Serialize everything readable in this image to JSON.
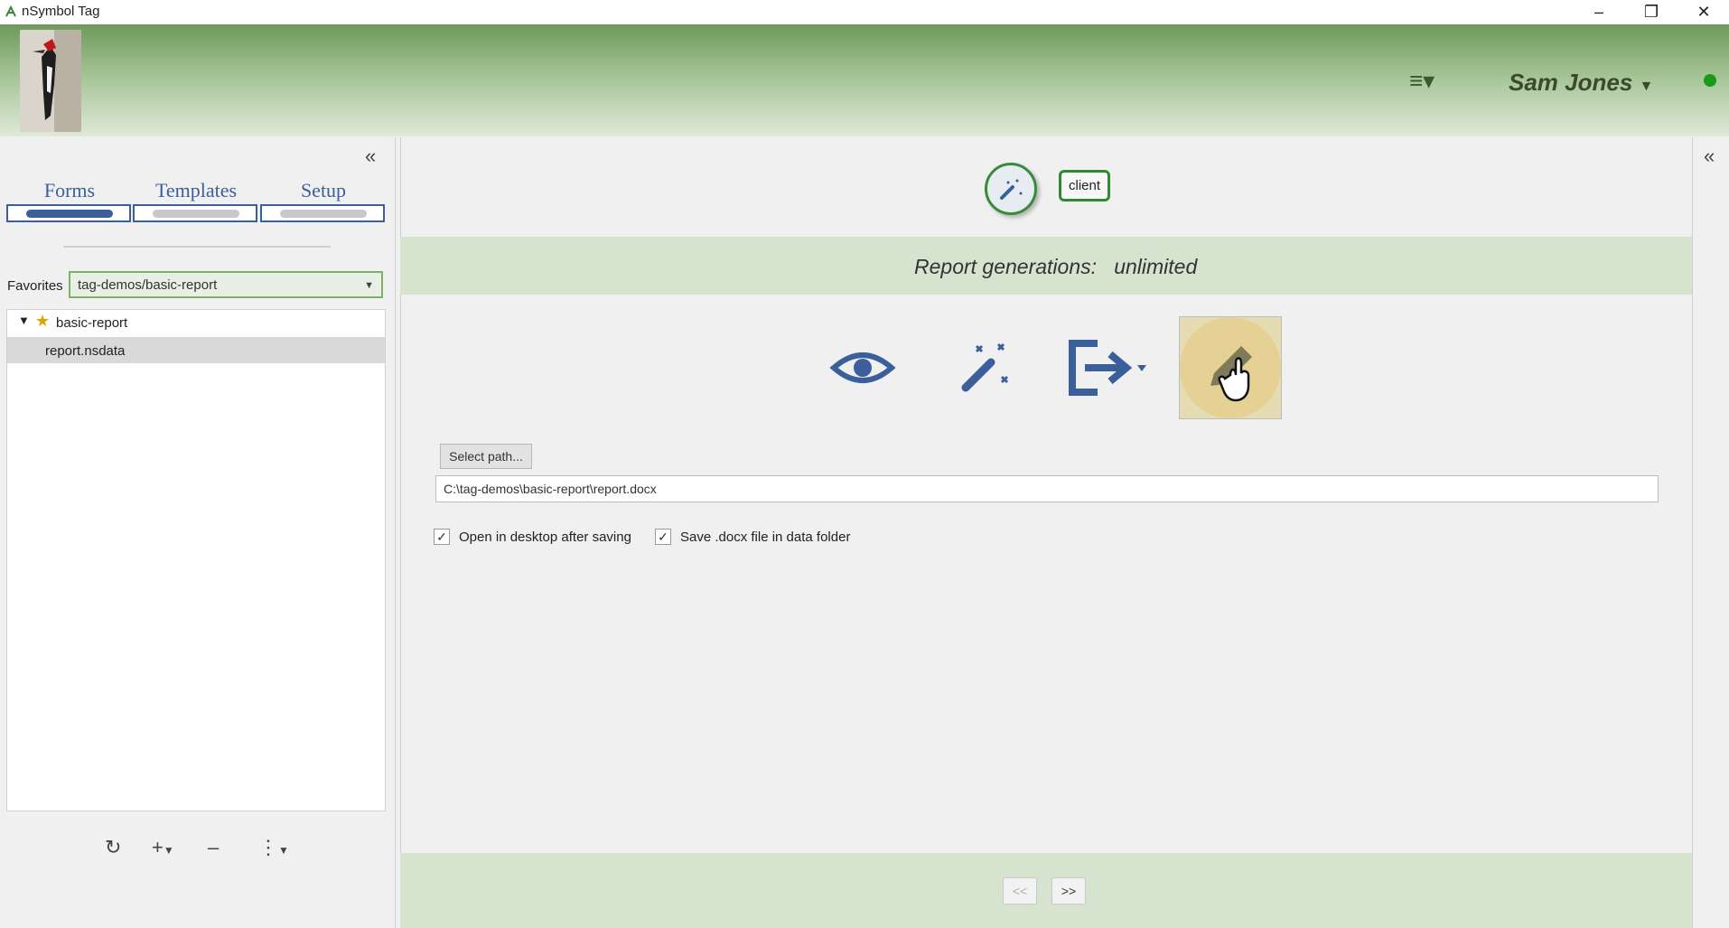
{
  "window": {
    "title": "nSymbol Tag",
    "minimize_icon": "minimize-icon",
    "maximize_icon": "restore-icon",
    "close_icon": "close-icon"
  },
  "header": {
    "menu_icon": "hamburger-menu-icon",
    "user_name": "Sam Jones",
    "status_color": "#1a9a1a"
  },
  "left_panel": {
    "tabs": [
      {
        "label": "Forms",
        "active": true
      },
      {
        "label": "Templates",
        "active": false
      },
      {
        "label": "Setup",
        "active": false
      }
    ],
    "favorites_label": "Favorites",
    "favorites_value": "tag-demos/basic-report",
    "tree": [
      {
        "label": "basic-report",
        "icon": "star-icon",
        "expanded": true
      },
      {
        "label": "report.nsdata",
        "selected": true
      }
    ],
    "toolbar": [
      "refresh-icon",
      "add-icon",
      "remove-icon",
      "more-icon"
    ]
  },
  "main": {
    "mode_badge": "client",
    "generations_label": "Report generations:",
    "generations_value": "unlimited",
    "actions": [
      "preview-eye-icon",
      "generate-wand-icon",
      "export-icon",
      "edit-pencil-icon"
    ],
    "select_path_label": "Select path...",
    "output_path": "C:\\tag-demos\\basic-report\\report.docx",
    "checkboxes": [
      {
        "label": "Open in desktop after saving",
        "checked": true
      },
      {
        "label": "Save .docx file in data folder",
        "checked": true
      }
    ],
    "nav_prev": "<<",
    "nav_next": ">>"
  },
  "colors": {
    "accent_blue": "#3a5f9a",
    "accent_green": "#2f8a2f",
    "panel_green": "#d5e3cf"
  }
}
